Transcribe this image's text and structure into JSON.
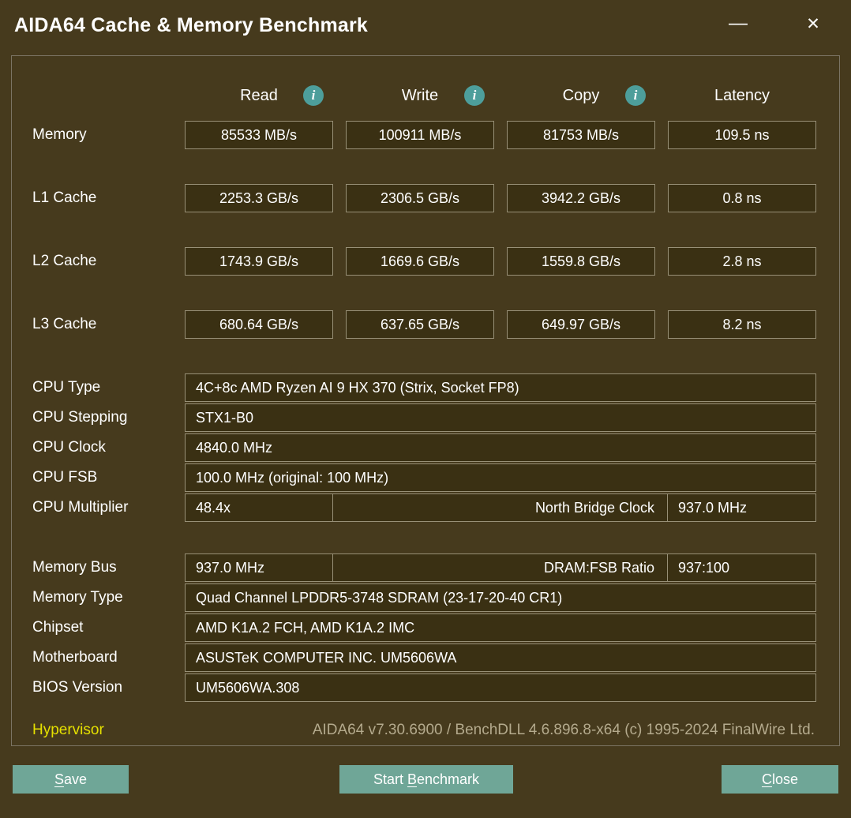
{
  "window": {
    "title": "AIDA64 Cache & Memory Benchmark"
  },
  "titlebar": {
    "minimize_glyph": "—",
    "close_glyph": "✕"
  },
  "colors": {
    "background": "#463a1d",
    "box_fill": "#3a3013",
    "box_border": "#989077",
    "info_icon_teal": "#4d9e9b",
    "button_teal": "#6fa697",
    "hypervisor_yellow": "#e5e000",
    "version_text": "#b4aa8d"
  },
  "header": {
    "info_glyph": "i",
    "columns": [
      {
        "label": "Read",
        "info": true
      },
      {
        "label": "Write",
        "info": true
      },
      {
        "label": "Copy",
        "info": true
      },
      {
        "label": "Latency",
        "info": false
      }
    ]
  },
  "bench": {
    "rows": [
      {
        "label": "Memory",
        "values": [
          "85533 MB/s",
          "100911 MB/s",
          "81753 MB/s",
          "109.5 ns"
        ]
      },
      {
        "label": "L1 Cache",
        "values": [
          "2253.3 GB/s",
          "2306.5 GB/s",
          "3942.2 GB/s",
          "0.8 ns"
        ]
      },
      {
        "label": "L2 Cache",
        "values": [
          "1743.9 GB/s",
          "1669.6 GB/s",
          "1559.8 GB/s",
          "2.8 ns"
        ]
      },
      {
        "label": "L3 Cache",
        "values": [
          "680.64 GB/s",
          "637.65 GB/s",
          "649.97 GB/s",
          "8.2 ns"
        ]
      }
    ]
  },
  "cpu": {
    "rows": [
      {
        "label": "CPU Type",
        "value": "4C+8c AMD Ryzen AI 9 HX 370  (Strix, Socket FP8)"
      },
      {
        "label": "CPU Stepping",
        "value": "STX1-B0"
      },
      {
        "label": "CPU Clock",
        "value": "4840.0 MHz"
      },
      {
        "label": "CPU FSB",
        "value": "100.0 MHz  (original: 100 MHz)"
      }
    ],
    "multiplier": {
      "label": "CPU Multiplier",
      "value": "48.4x",
      "nb_label": "North Bridge Clock",
      "nb_value": "937.0 MHz"
    }
  },
  "memory": {
    "bus": {
      "label": "Memory Bus",
      "value": "937.0 MHz",
      "ratio_label": "DRAM:FSB Ratio",
      "ratio_value": "937:100"
    },
    "rows": [
      {
        "label": "Memory Type",
        "value": "Quad Channel LPDDR5-3748 SDRAM  (23-17-20-40 CR1)"
      },
      {
        "label": "Chipset",
        "value": "AMD K1A.2 FCH, AMD K1A.2 IMC"
      },
      {
        "label": "Motherboard",
        "value": "ASUSTeK COMPUTER INC. UM5606WA"
      },
      {
        "label": "BIOS Version",
        "value": "UM5606WA.308"
      }
    ]
  },
  "footer": {
    "hypervisor_label": "Hypervisor",
    "version_text": "AIDA64 v7.30.6900 / BenchDLL 4.6.896.8-x64  (c) 1995-2024 FinalWire Ltd."
  },
  "buttons": {
    "save": {
      "pre": "",
      "key": "S",
      "post": "ave"
    },
    "start": {
      "pre": "Start ",
      "key": "B",
      "post": "enchmark"
    },
    "close": {
      "pre": "",
      "key": "C",
      "post": "lose"
    }
  }
}
